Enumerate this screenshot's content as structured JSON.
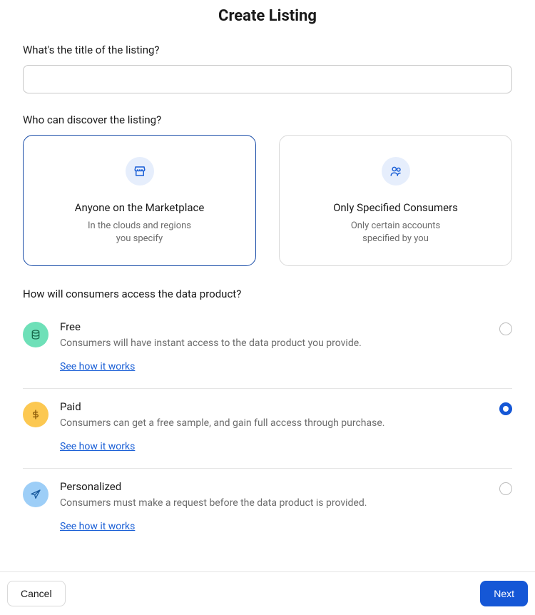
{
  "page": {
    "title": "Create Listing"
  },
  "sections": {
    "title_label": "What's the title of the listing?",
    "title_value": "",
    "title_placeholder": "",
    "discover_label": "Who can discover the listing?",
    "access_label": "How will consumers access the data product?"
  },
  "discover_options": {
    "marketplace": {
      "title": "Anyone on the Marketplace",
      "desc_line1": "In the clouds and regions",
      "desc_line2": "you specify",
      "selected": true
    },
    "specified": {
      "title": "Only Specified Consumers",
      "desc_line1": "Only certain accounts",
      "desc_line2": "specified by you",
      "selected": false
    }
  },
  "access_options": {
    "free": {
      "title": "Free",
      "desc": "Consumers will have instant access to the data product you provide.",
      "link": "See how it works",
      "selected": false
    },
    "paid": {
      "title": "Paid",
      "desc": "Consumers can get a free sample, and gain full access through purchase.",
      "link": "See how it works",
      "selected": true
    },
    "personalized": {
      "title": "Personalized",
      "desc": "Consumers must make a request before the data product is provided.",
      "link": "See how it works",
      "selected": false
    }
  },
  "footer": {
    "cancel": "Cancel",
    "next": "Next"
  }
}
